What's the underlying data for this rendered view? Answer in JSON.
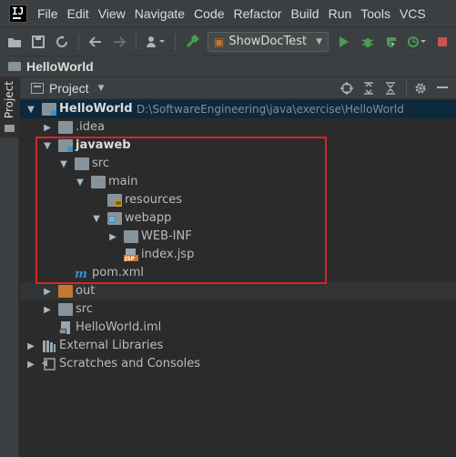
{
  "app": {
    "logo_text": "IJ"
  },
  "menu": [
    "File",
    "Edit",
    "View",
    "Navigate",
    "Code",
    "Refactor",
    "Build",
    "Run",
    "Tools",
    "VCS"
  ],
  "toolbar": {
    "run_config": "ShowDocTest",
    "icons": [
      "open-folder-icon",
      "save-icon",
      "sync-icon",
      "back-icon",
      "forward-icon",
      "user-icon",
      "build-hammer-icon",
      "run-icon",
      "debug-icon",
      "coverage-icon",
      "profile-icon",
      "stop-icon"
    ]
  },
  "navbar": {
    "title": "HelloWorld"
  },
  "side": {
    "tab_label": "Project"
  },
  "panel": {
    "title": "Project"
  },
  "tree": {
    "root": {
      "name": "HelloWorld",
      "path": "D:\\SoftwareEngineering\\java\\exercise\\HelloWorld"
    },
    "idea": ".idea",
    "javaweb": "javaweb",
    "src": "src",
    "main": "main",
    "resources": "resources",
    "webapp": "webapp",
    "webinf": "WEB-INF",
    "indexjsp": "index.jsp",
    "pom": "pom.xml",
    "out": "out",
    "src2": "src",
    "iml": "HelloWorld.iml",
    "ext": "External Libraries",
    "scratches": "Scratches and Consoles"
  },
  "colors": {
    "accent_highlight": "#d3262a",
    "selection": "#0d293e",
    "folder_out": "#c57632"
  }
}
